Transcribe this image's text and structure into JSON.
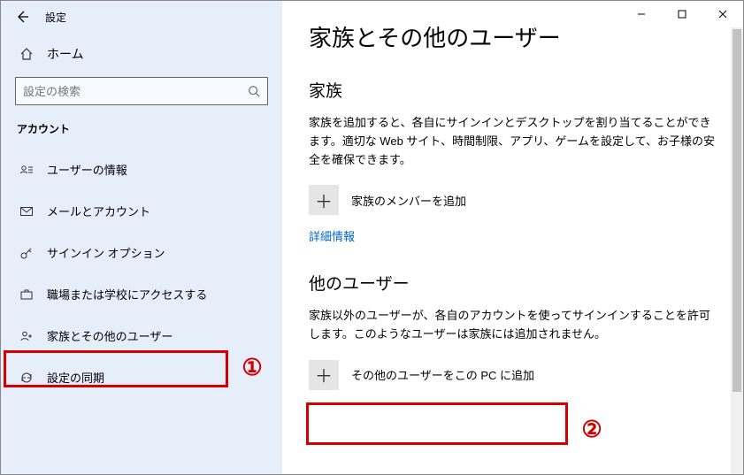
{
  "titlebar": {
    "title": "設定"
  },
  "home": {
    "label": "ホーム"
  },
  "search": {
    "placeholder": "設定の検索"
  },
  "section_label": "アカウント",
  "nav": {
    "items": [
      {
        "label": "ユーザーの情報"
      },
      {
        "label": "メールとアカウント"
      },
      {
        "label": "サインイン オプション"
      },
      {
        "label": "職場または学校にアクセスする"
      },
      {
        "label": "家族とその他のユーザー"
      },
      {
        "label": "設定の同期"
      }
    ]
  },
  "page": {
    "title": "家族とその他のユーザー",
    "family": {
      "heading": "家族",
      "desc": "家族を追加すると、各自にサインインとデスクトップを割り当てることができます。適切な Web サイト、時間制限、アプリ、ゲームを設定して、お子様の安全を確保できます。",
      "add_label": "家族のメンバーを追加",
      "link": "詳細情報"
    },
    "others": {
      "heading": "他のユーザー",
      "desc": "家族以外のユーザーが、各自のアカウントを使ってサインインすることを許可します。このようなユーザーは家族には追加されません。",
      "add_label": "その他のユーザーをこの PC に追加"
    }
  },
  "annotations": {
    "num1": "①",
    "num2": "②"
  }
}
